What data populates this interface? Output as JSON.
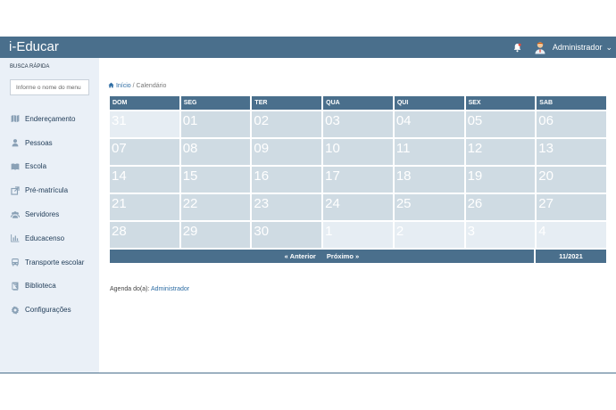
{
  "app": {
    "brand": "i-Educar"
  },
  "header": {
    "user": "Administrador",
    "bell_icon": "bell-icon",
    "avatar_icon": "user-avatar-icon"
  },
  "sidebar": {
    "quick_search_title": "BUSCA RÁPIDA",
    "quick_search_placeholder": "Informe o nome do menu",
    "items": [
      {
        "label": "Endereçamento",
        "icon": "map-icon"
      },
      {
        "label": "Pessoas",
        "icon": "person-icon"
      },
      {
        "label": "Escola",
        "icon": "book-icon"
      },
      {
        "label": "Pré-matrícula",
        "icon": "external-link-icon"
      },
      {
        "label": "Servidores",
        "icon": "group-icon"
      },
      {
        "label": "Educacenso",
        "icon": "bar-chart-icon"
      },
      {
        "label": "Transporte escolar",
        "icon": "bus-icon"
      },
      {
        "label": "Biblioteca",
        "icon": "library-book-icon"
      },
      {
        "label": "Configurações",
        "icon": "gear-icon"
      }
    ]
  },
  "breadcrumb": {
    "home": "Início",
    "separator": " / ",
    "current": "Calendário"
  },
  "calendar": {
    "weekdays": [
      "DOM",
      "SEG",
      "TER",
      "QUA",
      "QUI",
      "SEX",
      "SAB"
    ],
    "days": [
      "31",
      "01",
      "02",
      "03",
      "04",
      "05",
      "06",
      "07",
      "08",
      "09",
      "10",
      "11",
      "12",
      "13",
      "14",
      "15",
      "16",
      "17",
      "18",
      "19",
      "20",
      "21",
      "22",
      "23",
      "24",
      "25",
      "26",
      "27",
      "28",
      "29",
      "30",
      "1",
      "2",
      "3",
      "4"
    ],
    "prev_label": "« Anterior",
    "next_label": "Próximo »",
    "month": "11/2021"
  },
  "agenda": {
    "label": "Agenda do(a): ",
    "owner": "Administrador"
  },
  "colors": {
    "primary": "#4a6f8c",
    "cell": "#cfdbe3",
    "cell_muted": "#e6edf3",
    "sidebar": "#eaf0f7"
  }
}
